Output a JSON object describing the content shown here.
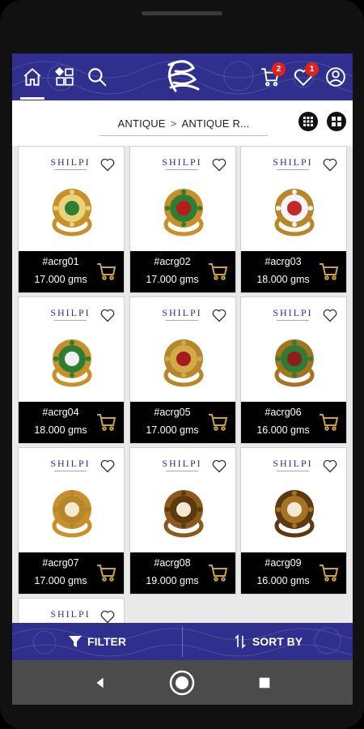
{
  "header": {
    "cart_count": "2",
    "wishlist_count": "1"
  },
  "breadcrumb": {
    "items": [
      "ANTIQUE",
      "ANTIQUE R..."
    ],
    "separator": ">"
  },
  "brand_text": "SHILPI",
  "products": [
    {
      "code": "#acrg01",
      "weight": "17.000 gms"
    },
    {
      "code": "#acrg02",
      "weight": "17.000 gms"
    },
    {
      "code": "#acrg03",
      "weight": "18.000 gms"
    },
    {
      "code": "#acrg04",
      "weight": "18.000 gms"
    },
    {
      "code": "#acrg05",
      "weight": "17.000 gms"
    },
    {
      "code": "#acrg06",
      "weight": "16.000 gms"
    },
    {
      "code": "#acrg07",
      "weight": "17.000 gms"
    },
    {
      "code": "#acrg08",
      "weight": "19.000 gms"
    },
    {
      "code": "#acrg09",
      "weight": "16.000 gms"
    }
  ],
  "bottom_bar": {
    "filter_label": "FILTER",
    "sort_label": "SORT BY"
  },
  "colors": {
    "primary": "#2f2f8e",
    "badge": "#e2231a",
    "card_footer": "#000000",
    "cart_icon": "#c9a24a"
  }
}
